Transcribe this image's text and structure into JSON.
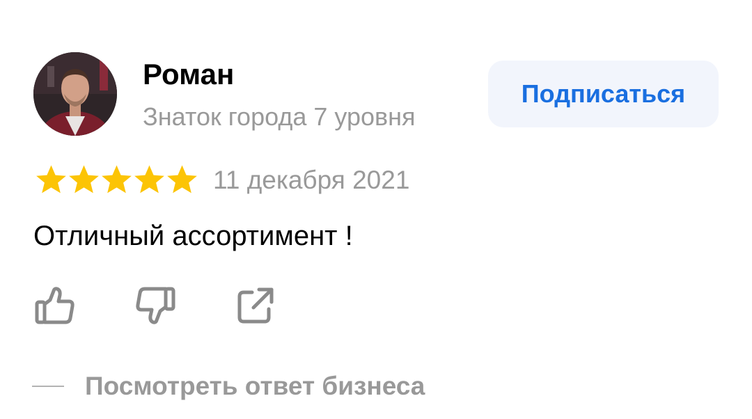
{
  "author": {
    "name": "Роман",
    "level": "Знаток города 7 уровня",
    "avatar_icon": "user-photo"
  },
  "subscribe": {
    "label": "Подписаться"
  },
  "rating": {
    "stars": 5,
    "max": 5,
    "star_color": "#fcc405",
    "icon": "star-icon"
  },
  "review": {
    "date": "11 декабря 2021",
    "text": "Отличный ассортимент !"
  },
  "actions": {
    "like_icon": "thumbs-up-icon",
    "dislike_icon": "thumbs-down-icon",
    "share_icon": "share-icon"
  },
  "business_reply": {
    "label": "Посмотреть ответ бизнеса"
  },
  "colors": {
    "accent": "#1a6fe0",
    "secondary_text": "#999999",
    "button_bg": "#f2f5fc",
    "icon_gray": "#8a8a8a"
  }
}
